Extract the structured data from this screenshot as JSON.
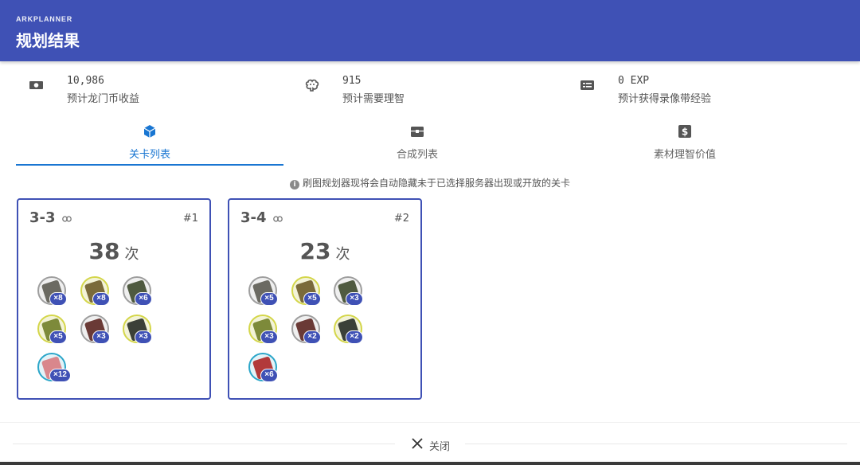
{
  "header": {
    "subtitle": "ARKPLANNER",
    "title": "规划结果"
  },
  "stats": [
    {
      "icon": "money-icon",
      "value": "10,986",
      "label": "预计龙门币收益"
    },
    {
      "icon": "brain-icon",
      "value": "915",
      "label": "预计需要理智"
    },
    {
      "icon": "card-icon",
      "value": "0 EXP",
      "label": "预计获得录像带经验"
    }
  ],
  "tabs": [
    {
      "icon": "cube-icon",
      "label": "关卡列表",
      "active": true
    },
    {
      "icon": "chest-icon",
      "label": "合成列表",
      "active": false
    },
    {
      "icon": "dollar-icon",
      "label": "素材理智价值",
      "active": false
    }
  ],
  "notice": "刷图规划器现将会自动隐藏未于已选择服务器出现或开放的关卡",
  "cards": [
    {
      "stage": "3-3",
      "rank": "#1",
      "times": "38",
      "unit": "次",
      "items": [
        {
          "count": "×8",
          "tier": "gray",
          "color": "#6b6a62"
        },
        {
          "count": "×8",
          "tier": "yellow",
          "color": "#7a6a3a"
        },
        {
          "count": "×6",
          "tier": "gray",
          "color": "#4f5a40"
        },
        {
          "count": "×5",
          "tier": "yellow",
          "color": "#7d8a3a"
        },
        {
          "count": "×3",
          "tier": "gray",
          "color": "#6a3a36"
        },
        {
          "count": "×3",
          "tier": "yellow",
          "color": "#3b4038"
        },
        {
          "count": "×12",
          "tier": "blue",
          "color": "#d9878c"
        }
      ]
    },
    {
      "stage": "3-4",
      "rank": "#2",
      "times": "23",
      "unit": "次",
      "items": [
        {
          "count": "×5",
          "tier": "gray",
          "color": "#6b6a62"
        },
        {
          "count": "×5",
          "tier": "yellow",
          "color": "#7a6a3a"
        },
        {
          "count": "×3",
          "tier": "gray",
          "color": "#4f5a40"
        },
        {
          "count": "×3",
          "tier": "yellow",
          "color": "#7d8a3a"
        },
        {
          "count": "×2",
          "tier": "gray",
          "color": "#6a3a36"
        },
        {
          "count": "×2",
          "tier": "yellow",
          "color": "#3b4038"
        },
        {
          "count": "×6",
          "tier": "blue",
          "color": "#b23a3a"
        }
      ]
    }
  ],
  "footer": {
    "close_label": "关闭"
  },
  "colors": {
    "primary": "#3f51b5",
    "tab_active": "#1976d2"
  }
}
